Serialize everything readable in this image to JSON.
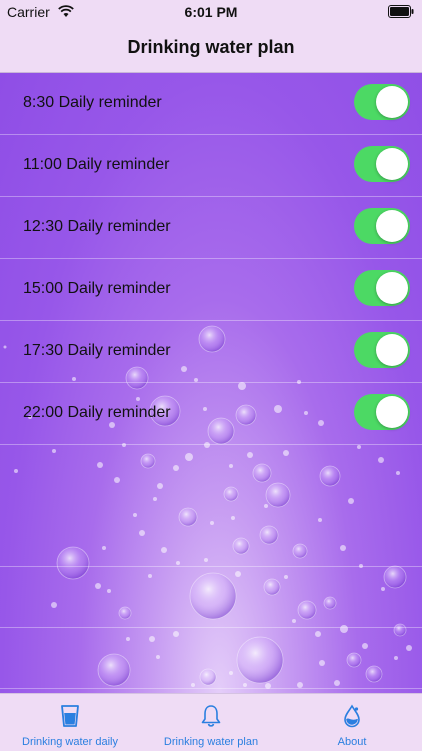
{
  "status_bar": {
    "carrier": "Carrier",
    "time": "6:01 PM",
    "wifi_icon": "wifi-icon",
    "battery_icon": "battery-icon"
  },
  "nav": {
    "title": "Drinking water plan"
  },
  "reminders": [
    {
      "label": "8:30 Daily reminder",
      "enabled": true
    },
    {
      "label": "11:00 Daily reminder",
      "enabled": true
    },
    {
      "label": "12:30 Daily reminder",
      "enabled": true
    },
    {
      "label": "15:00 Daily reminder",
      "enabled": true
    },
    {
      "label": "17:30 Daily reminder",
      "enabled": true
    },
    {
      "label": "22:00 Daily reminder",
      "enabled": true
    }
  ],
  "tabs": [
    {
      "label": "Drinking water daily",
      "icon": "glass-icon"
    },
    {
      "label": "Drinking water plan",
      "icon": "bell-icon"
    },
    {
      "label": "About",
      "icon": "water-drop-icon"
    }
  ],
  "colors": {
    "switch_on": "#4cd964",
    "tab_tint": "#2a7fe0",
    "bar_background": "#efdcf5",
    "content_purple": "#9757e9"
  }
}
